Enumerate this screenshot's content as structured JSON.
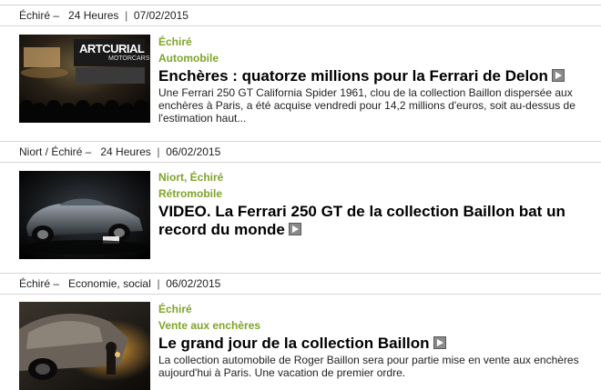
{
  "articles": [
    {
      "meta_place": "Échiré –",
      "meta_source": "24 Heures",
      "meta_date": "07/02/2015",
      "location": "Échiré",
      "category": "Automobile",
      "title": "Enchères : quatorze millions pour la Ferrari de Delon",
      "description": "Une Ferrari 250 GT California Spider 1961, clou de la collection Baillon dispersée aux enchères à Paris, a été acquise vendredi pour 14,2 millions d'euros, soit au-dessus de l'estimation haut...",
      "thumb_text": "ARTCURIAL",
      "thumb_sub": "MOTORCARS"
    },
    {
      "meta_place": "Niort / Échiré –",
      "meta_source": "24 Heures",
      "meta_date": "06/02/2015",
      "location": "Niort, Échiré",
      "category": "Rétromobile",
      "title": "VIDEO. La Ferrari 250 GT de la collection Baillon bat un record du monde",
      "description": ""
    },
    {
      "meta_place": "Échiré –",
      "meta_source": "Economie, social",
      "meta_date": "06/02/2015",
      "location": "Échiré",
      "category": "Vente aux enchères",
      "title": "Le grand jour de la collection Baillon",
      "description": "La collection automobile de Roger Baillon sera pour partie mise en vente aux enchères aujourd'hui à Paris. Une vacation de premier ordre."
    }
  ],
  "meta_separator": "|",
  "colors": {
    "accent": "#7fa42a",
    "divider": "#d6d6d6"
  },
  "icons": {
    "play": "play-icon"
  }
}
